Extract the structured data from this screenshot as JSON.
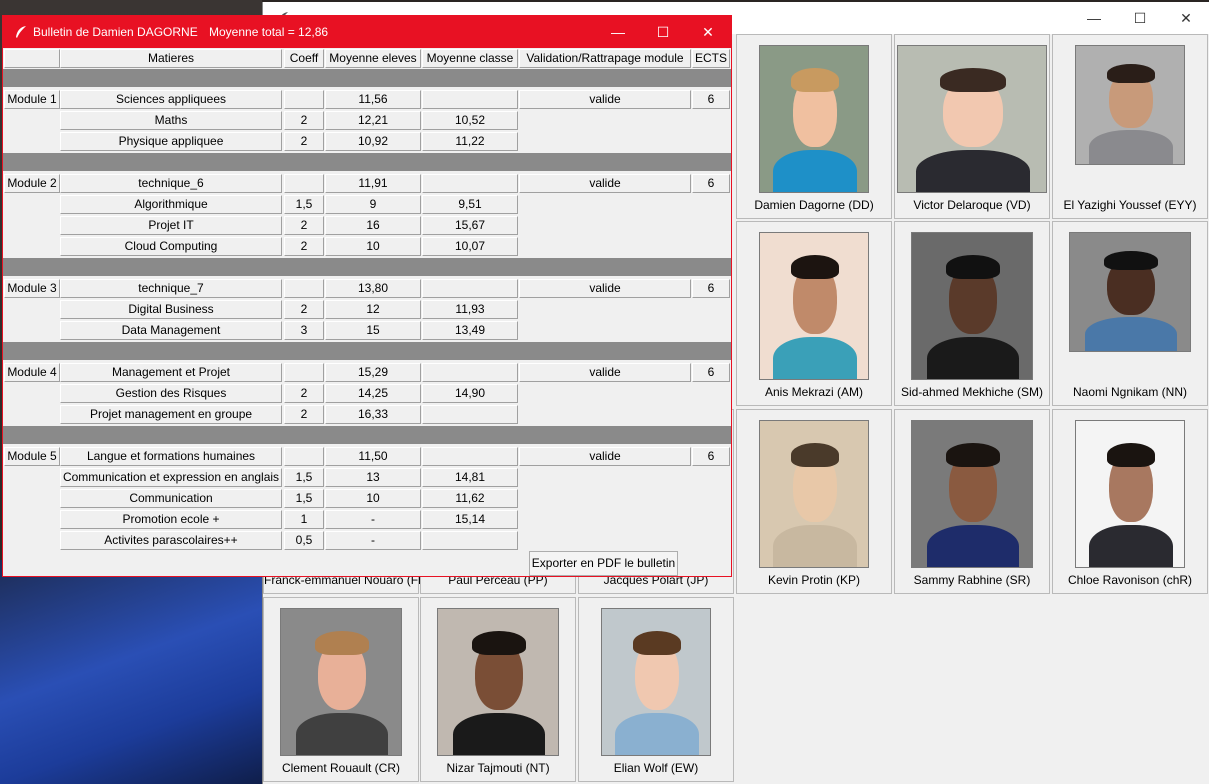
{
  "back_window": {
    "title": "",
    "students": [
      {
        "name": "Damien Dagorne (DD)"
      },
      {
        "name": "Victor Delaroque (VD)"
      },
      {
        "name": "El Yazighi Youssef (EYY)"
      },
      {
        "name": "Anis Mekrazi (AM)"
      },
      {
        "name": "Sid-ahmed Mekhiche (SM)"
      },
      {
        "name": "Naomi Ngnikam (NN)"
      },
      {
        "name": "Franck-emmanuel Nouaro (FN)"
      },
      {
        "name": "Paul Perceau (PP)"
      },
      {
        "name": "Jacques Polart (JP)"
      },
      {
        "name": "Kevin Protin (KP)"
      },
      {
        "name": "Sammy Rabhine (SR)"
      },
      {
        "name": "Chloe Ravonison (chR)"
      },
      {
        "name": "Clement Rouault (CR)"
      },
      {
        "name": "Nizar Tajmouti (NT)"
      },
      {
        "name": "Elian Wolf (EW)"
      }
    ]
  },
  "bulletin": {
    "title": "Bulletin de Damien DAGORNE",
    "average_label": "Moyenne total = 12,86",
    "headers": {
      "matieres": "Matieres",
      "coeff": "Coeff",
      "moy_eleves": "Moyenne eleves",
      "moy_classe": "Moyenne classe",
      "validation": "Validation/Rattrapage module",
      "ects": "ECTS"
    },
    "modules": [
      {
        "label": "Module 1",
        "name": "Sciences appliquees",
        "moyenne": "11,56",
        "validation": "valide",
        "ects": "6",
        "subjects": [
          {
            "name": "Maths",
            "coeff": "2",
            "eleve": "12,21",
            "classe": "10,52"
          },
          {
            "name": "Physique appliquee",
            "coeff": "2",
            "eleve": "10,92",
            "classe": "11,22"
          }
        ]
      },
      {
        "label": "Module 2",
        "name": "technique_6",
        "moyenne": "11,91",
        "validation": "valide",
        "ects": "6",
        "subjects": [
          {
            "name": "Algorithmique",
            "coeff": "1,5",
            "eleve": "9",
            "classe": "9,51"
          },
          {
            "name": "Projet IT",
            "coeff": "2",
            "eleve": "16",
            "classe": "15,67"
          },
          {
            "name": "Cloud Computing",
            "coeff": "2",
            "eleve": "10",
            "classe": "10,07"
          }
        ]
      },
      {
        "label": "Module 3",
        "name": "technique_7",
        "moyenne": "13,80",
        "validation": "valide",
        "ects": "6",
        "subjects": [
          {
            "name": "Digital Business",
            "coeff": "2",
            "eleve": "12",
            "classe": "11,93"
          },
          {
            "name": "Data Management",
            "coeff": "3",
            "eleve": "15",
            "classe": "13,49"
          }
        ]
      },
      {
        "label": "Module 4",
        "name": "Management et Projet",
        "moyenne": "15,29",
        "validation": "valide",
        "ects": "6",
        "subjects": [
          {
            "name": "Gestion des Risques",
            "coeff": "2",
            "eleve": "14,25",
            "classe": "14,90"
          },
          {
            "name": "Projet management en groupe",
            "coeff": "2",
            "eleve": "16,33",
            "classe": ""
          }
        ]
      },
      {
        "label": "Module 5",
        "name": "Langue et formations humaines",
        "moyenne": "11,50",
        "validation": "valide",
        "ects": "6",
        "subjects": [
          {
            "name": "Communication et expression en anglais",
            "coeff": "1,5",
            "eleve": "13",
            "classe": "14,81"
          },
          {
            "name": "Communication",
            "coeff": "1,5",
            "eleve": "10",
            "classe": "11,62"
          },
          {
            "name": "Promotion ecole +",
            "coeff": "1",
            "eleve": "-",
            "classe": "15,14"
          },
          {
            "name": "Activites parascolaires++",
            "coeff": "0,5",
            "eleve": "-",
            "classe": ""
          }
        ]
      }
    ],
    "export_label": "Exporter en PDF le bulletin"
  },
  "window_controls": {
    "minimize": "—",
    "maximize": "☐",
    "close": "✕"
  },
  "colors": {
    "title_active": "#e81123",
    "separator": "#8a8a8a"
  }
}
